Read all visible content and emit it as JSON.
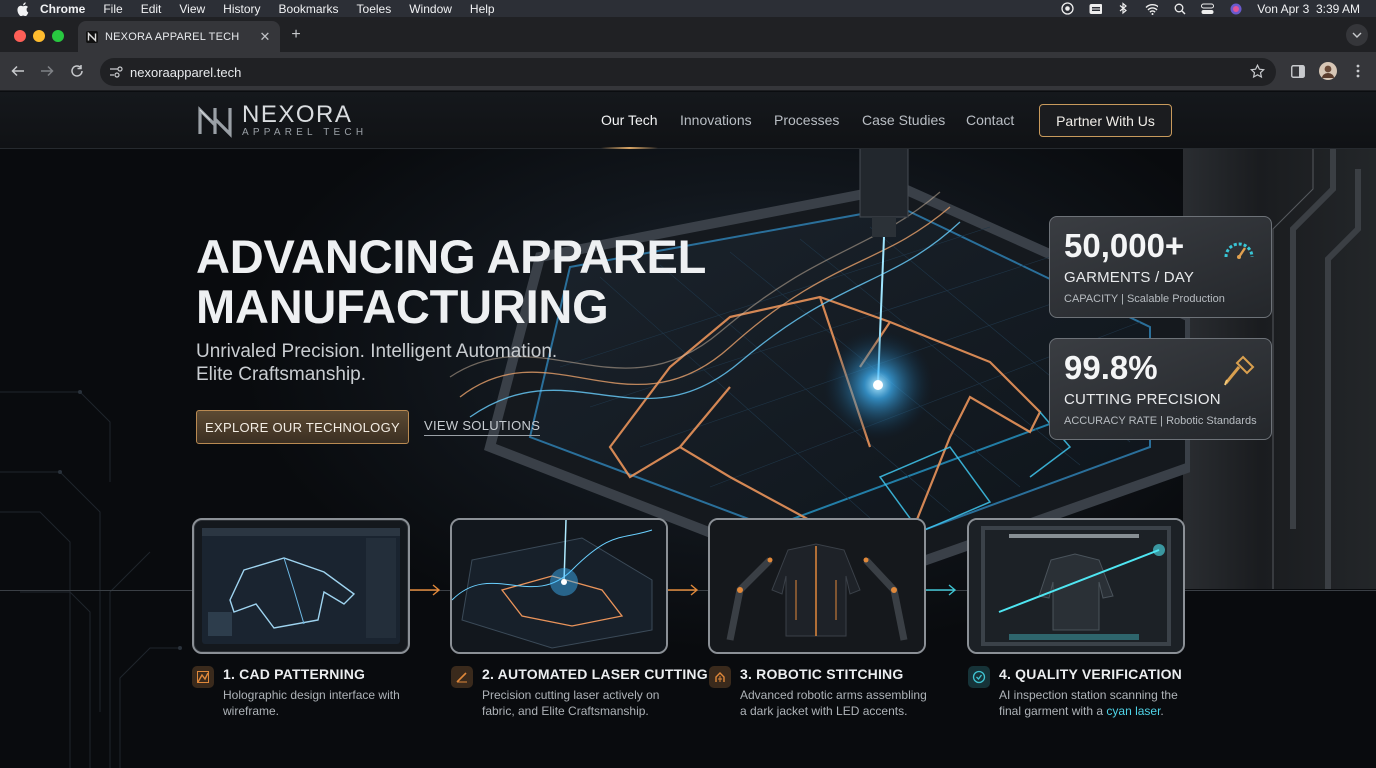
{
  "menubar": {
    "app": "Chrome",
    "items": [
      "File",
      "Edit",
      "View",
      "History",
      "Bookmarks",
      "Toeles",
      "Window",
      "Help"
    ],
    "clock": "Von Apr 3  3:39 AM"
  },
  "browser": {
    "tab_title": "NEXORA APPAREL TECH",
    "url": "nexoraapparel.tech"
  },
  "site": {
    "logo_name": "NEXORA",
    "logo_sub": "APPAREL TECH",
    "nav": [
      "Our Tech",
      "Innovations",
      "Processes",
      "Case Studies",
      "Contact"
    ],
    "active_nav": "Our Tech",
    "cta": "Partner With Us"
  },
  "hero": {
    "title_line1": "ADVANCING APPAREL",
    "title_line2": "MANUFACTURING",
    "sub_line1": "Unrivaled Precision. Intelligent Automation.",
    "sub_line2": "Elite Craftsmanship.",
    "primary_button": "EXPLORE OUR TECHNOLOGY",
    "secondary_link": "VIEW SOLUTIONS"
  },
  "stats": [
    {
      "value": "50,000+",
      "label": "GARMENTS / DAY",
      "caption": "CAPACITY | Scalable Production",
      "icon": "gauge-icon",
      "accent": "#39c6d6"
    },
    {
      "value": "99.8%",
      "label": "CUTTING PRECISION",
      "caption": "ACCURACY RATE | Robotic Standards",
      "icon": "laser-tool-icon",
      "accent": "#d9a04f"
    }
  ],
  "process": [
    {
      "title": "1. CAD PATTERNING",
      "desc1": "Holographic design interface with",
      "desc2": "wireframe.",
      "icon": "pattern-icon",
      "accent": "#c77b39"
    },
    {
      "title": "2. AUTOMATED LASER CUTTING",
      "desc1": "Precision cutting laser actively on",
      "desc2": "fabric, and Elite Craftsmanship.",
      "icon": "laser-icon",
      "accent": "#c77b39"
    },
    {
      "title": "3. ROBOTIC STITCHING",
      "desc1": "Advanced robotic arms assembling",
      "desc2": "a dark jacket with LED accents.",
      "icon": "robot-icon",
      "accent": "#c77b39"
    },
    {
      "title": "4. QUALITY VERIFICATION",
      "desc1": "AI inspection station scanning the",
      "desc2_pre": "final garment with a ",
      "desc2_hl": "cyan laser",
      "desc2_post": ".",
      "icon": "check-shield-icon",
      "accent": "#3fc4d2"
    }
  ],
  "colors": {
    "gold": "#c89a5c",
    "cyan": "#3fd0e4",
    "orange": "#e0883a"
  }
}
